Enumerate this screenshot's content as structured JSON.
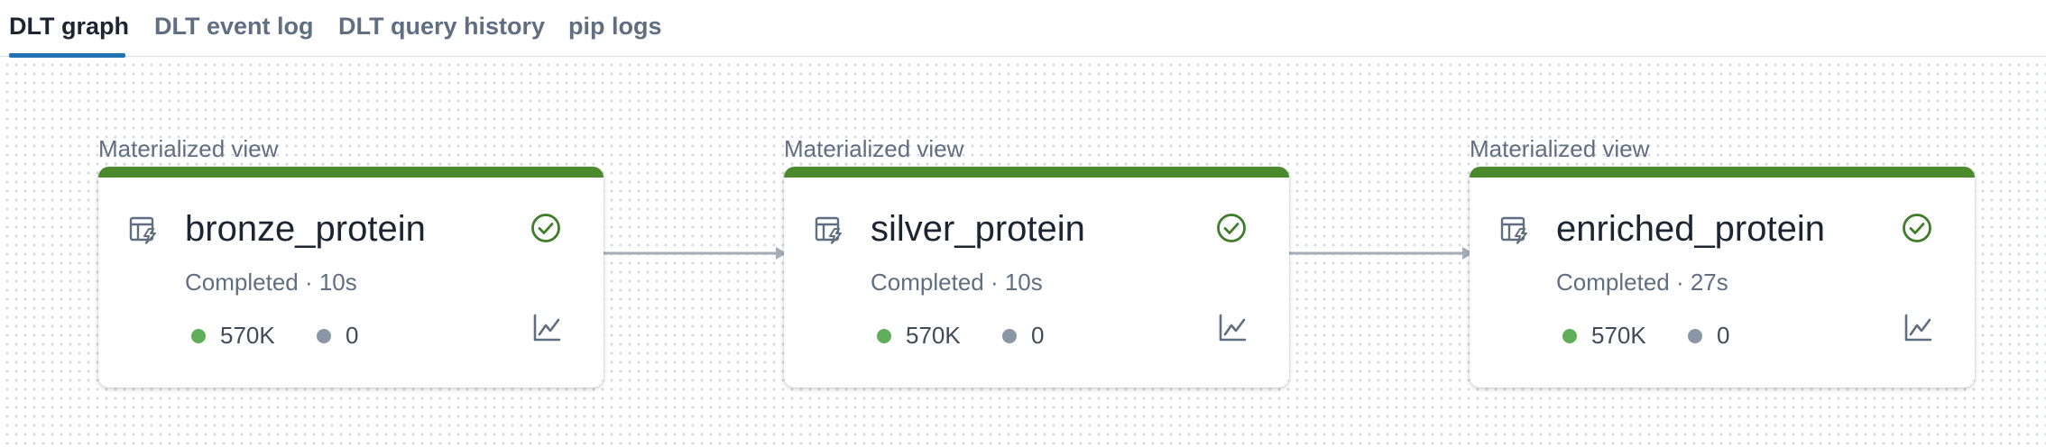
{
  "tabs": [
    {
      "label": "DLT graph",
      "active": true
    },
    {
      "label": "DLT event log",
      "active": false
    },
    {
      "label": "DLT query history",
      "active": false
    },
    {
      "label": "pip logs",
      "active": false
    }
  ],
  "colors": {
    "accent": "#2272b4",
    "status_ok": "#4a8a2c",
    "rows_written_dot": "#5fae5a",
    "rows_dropped_dot": "#8a96a3"
  },
  "nodes": [
    {
      "caption": "Materialized view",
      "name": "bronze_protein",
      "status": "Completed · 10s",
      "rows_written": "570K",
      "rows_dropped": "0",
      "type_icon": "materialized-view-icon",
      "status_icon": "check-circle-icon",
      "metrics_icon": "line-chart-icon"
    },
    {
      "caption": "Materialized view",
      "name": "silver_protein",
      "status": "Completed · 10s",
      "rows_written": "570K",
      "rows_dropped": "0",
      "type_icon": "materialized-view-icon",
      "status_icon": "check-circle-icon",
      "metrics_icon": "line-chart-icon"
    },
    {
      "caption": "Materialized view",
      "name": "enriched_protein",
      "status": "Completed · 27s",
      "rows_written": "570K",
      "rows_dropped": "0",
      "type_icon": "materialized-view-icon",
      "status_icon": "check-circle-icon",
      "metrics_icon": "line-chart-icon"
    }
  ]
}
